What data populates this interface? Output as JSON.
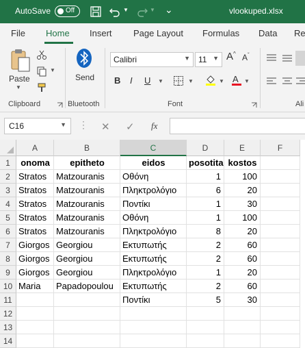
{
  "titlebar": {
    "autosave_label": "AutoSave",
    "toggle_label": "Off",
    "filename": "vlookuped.xlsx",
    "accent": "#217346"
  },
  "tabs": [
    "File",
    "Home",
    "Insert",
    "Page Layout",
    "Formulas",
    "Data",
    "Re"
  ],
  "active_tab": "Home",
  "ribbon": {
    "paste_label": "Paste",
    "clipboard_label": "Clipboard",
    "send_label": "Send",
    "bluetooth_label": "Bluetooth",
    "font_name": "Calibri",
    "font_size": "11",
    "font_label": "Font",
    "bold": "B",
    "italic": "I",
    "underline": "U",
    "alignment_label": "Ali",
    "font_color": "#e81123",
    "highlight_color": "#ffff00"
  },
  "formula_bar": {
    "name_box": "C16",
    "fx": "fx",
    "formula": ""
  },
  "sheet": {
    "columns": [
      "A",
      "B",
      "C",
      "D",
      "E",
      "F"
    ],
    "selected_column": "C",
    "rows": [
      "1",
      "2",
      "3",
      "4",
      "5",
      "6",
      "7",
      "8",
      "9",
      "10",
      "11",
      "12",
      "13",
      "14"
    ],
    "header": [
      "onoma",
      "epitheto",
      "eidos",
      "posotita",
      "kostos"
    ],
    "data": [
      [
        "Stratos",
        "Matzouranis",
        "Οθόνη",
        "1",
        "100"
      ],
      [
        "Stratos",
        "Matzouranis",
        "Πληκτρολόγιο",
        "6",
        "20"
      ],
      [
        "Stratos",
        "Matzouranis",
        "Ποντίκι",
        "1",
        "30"
      ],
      [
        "Stratos",
        "Matzouranis",
        "Οθόνη",
        "1",
        "100"
      ],
      [
        "Stratos",
        "Matzouranis",
        "Πληκτρολόγιο",
        "8",
        "20"
      ],
      [
        "Giorgos",
        "Georgiou",
        "Εκτυπωτής",
        "2",
        "60"
      ],
      [
        "Giorgos",
        "Georgiou",
        "Εκτυπωτής",
        "2",
        "60"
      ],
      [
        "Giorgos",
        "Georgiou",
        "Πληκτρολόγιο",
        "1",
        "20"
      ],
      [
        "Maria",
        "Papadopoulou",
        "Εκτυπωτής",
        "2",
        "60"
      ],
      [
        "",
        "",
        "Ποντίκι",
        "5",
        "30"
      ]
    ]
  }
}
